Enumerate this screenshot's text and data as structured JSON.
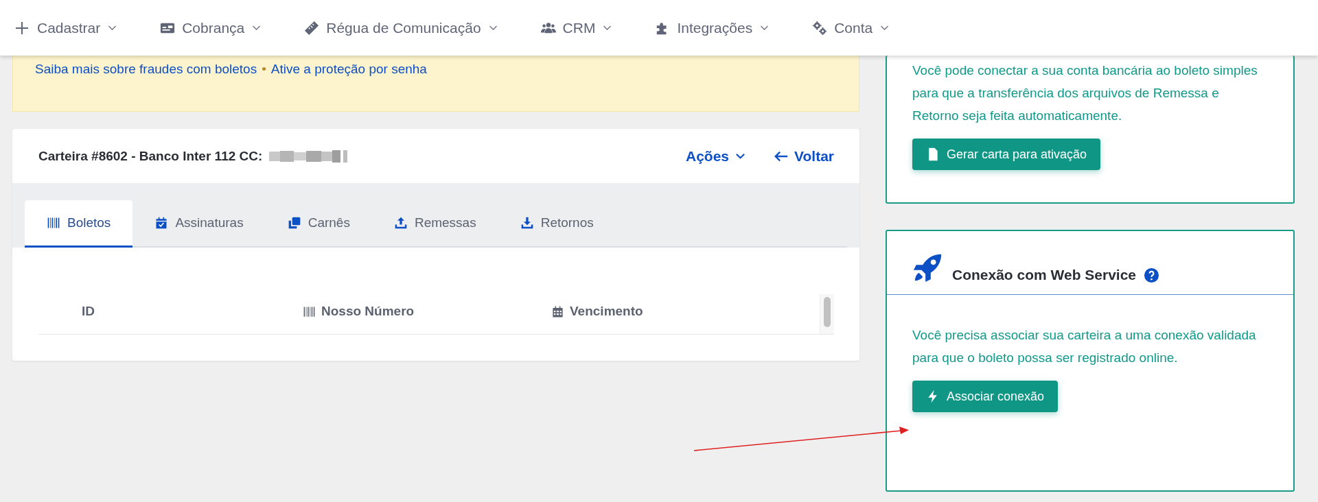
{
  "nav": {
    "items": [
      {
        "label": "Cadastrar"
      },
      {
        "label": "Cobrança"
      },
      {
        "label": "Régua de Comunicação"
      },
      {
        "label": "CRM"
      },
      {
        "label": "Integrações"
      },
      {
        "label": "Conta"
      }
    ]
  },
  "alert": {
    "links": [
      "Saiba mais sobre fraudes com boletos",
      "Ative a proteção por senha"
    ],
    "separator": "•"
  },
  "wallet": {
    "title": "Carteira #8602 - Banco Inter 112 CC:",
    "actions": [
      {
        "label": "Ações",
        "kind": "dropdown"
      },
      {
        "label": "Voltar",
        "kind": "back"
      }
    ],
    "tabs": [
      {
        "label": "Boletos",
        "selected": true
      },
      {
        "label": "Assinaturas",
        "selected": false
      },
      {
        "label": "Carnês",
        "selected": false
      },
      {
        "label": "Remessas",
        "selected": false
      },
      {
        "label": "Retornos",
        "selected": false
      }
    ],
    "table": {
      "columns": [
        "ID",
        "Nosso Número",
        "Vencimento"
      ]
    }
  },
  "side_cards": [
    {
      "kind": "letter",
      "paragraph": "Você pode conectar a sua conta bancária ao boleto simples para que a transferência dos arquivos de Remessa e Retorno seja feita automaticamente.",
      "button": "Gerar carta para ativação"
    },
    {
      "kind": "connection",
      "title": "Conexão com Web Service",
      "paragraph": "Você precisa associar sua carteira a uma conexão validada para que o boleto possa ser registrado online.",
      "button": "Associar conexão"
    }
  ]
}
